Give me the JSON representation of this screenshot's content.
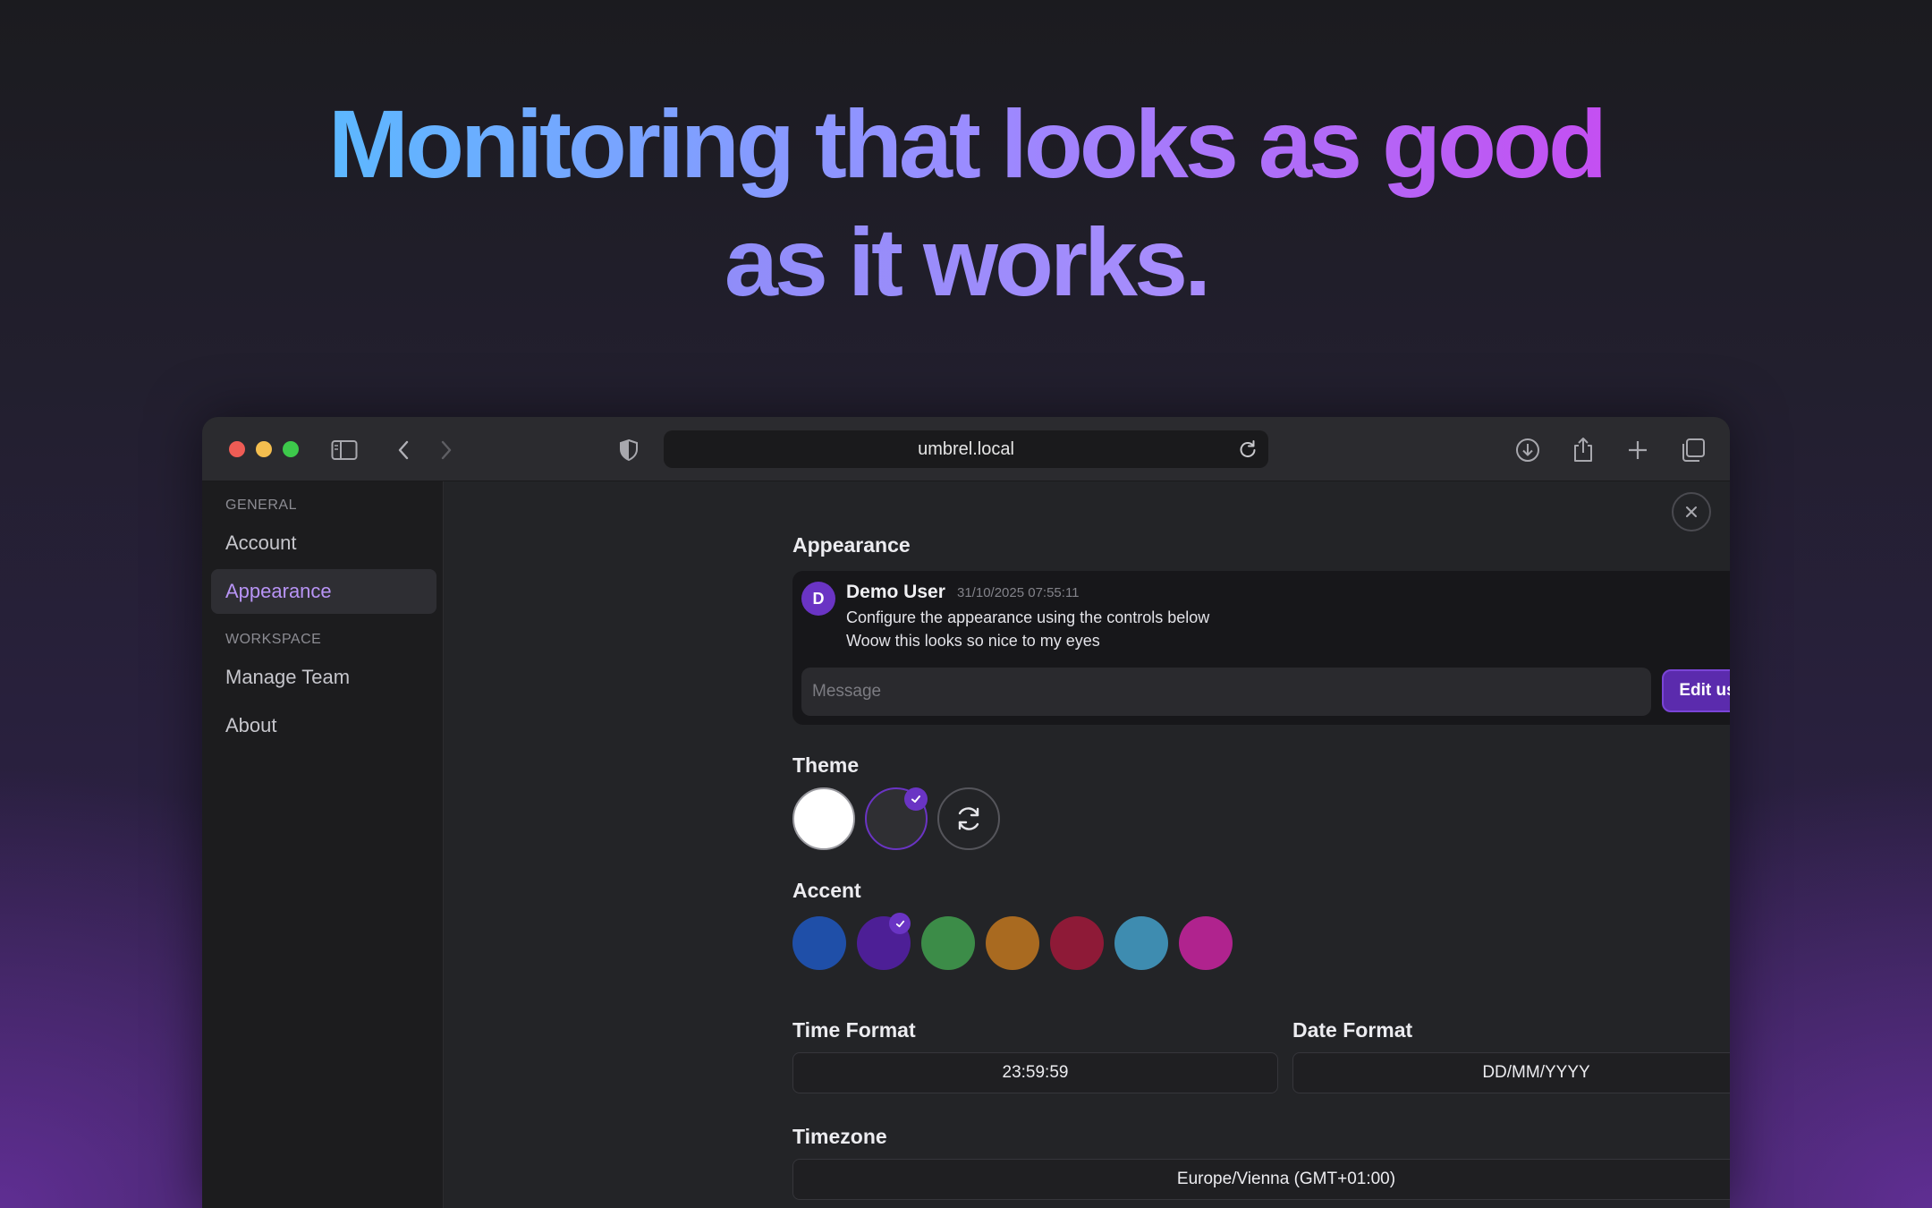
{
  "headline": {
    "line1": "Monitoring that looks as good",
    "line2": "as it works."
  },
  "browser": {
    "url": "umbrel.local",
    "icons": [
      "sidebar-icon",
      "back-icon",
      "forward-icon",
      "shield-icon",
      "reload-icon",
      "download-icon",
      "share-icon",
      "plus-icon",
      "tabs-icon"
    ]
  },
  "sidebar": {
    "general_label": "GENERAL",
    "workspace_label": "WORKSPACE",
    "items": [
      {
        "label": "Account",
        "active": false
      },
      {
        "label": "Appearance",
        "active": true
      },
      {
        "label": "Manage Team",
        "active": false
      },
      {
        "label": "About",
        "active": false
      }
    ]
  },
  "appearance": {
    "title": "Appearance",
    "chat": {
      "avatar_letter": "D",
      "user": "Demo User",
      "timestamp": "31/10/2025 07:55:11",
      "lines": [
        "Configure the appearance using the controls below",
        "Woow this looks so nice to my eyes"
      ],
      "input_placeholder": "Message",
      "edit_label": "Edit user"
    },
    "theme_title": "Theme",
    "themes": [
      {
        "name": "light",
        "color": "#ffffff",
        "selected": false
      },
      {
        "name": "dark",
        "color": "#2f2f33",
        "selected": true
      },
      {
        "name": "system",
        "color": "#232427",
        "selected": false
      }
    ],
    "accent_title": "Accent",
    "accents": [
      {
        "color": "#1f4fa8",
        "selected": false
      },
      {
        "color": "#4d1f96",
        "selected": true
      },
      {
        "color": "#3c8c48",
        "selected": false
      },
      {
        "color": "#a96a20",
        "selected": false
      },
      {
        "color": "#8e1a37",
        "selected": false
      },
      {
        "color": "#3e8cb0",
        "selected": false
      },
      {
        "color": "#b0238e",
        "selected": false
      }
    ],
    "time_format_title": "Time Format",
    "time_format_value": "23:59:59",
    "date_format_title": "Date Format",
    "date_format_value": "DD/MM/YYYY",
    "timezone_title": "Timezone",
    "timezone_value": "Europe/Vienna (GMT+01:00)"
  }
}
